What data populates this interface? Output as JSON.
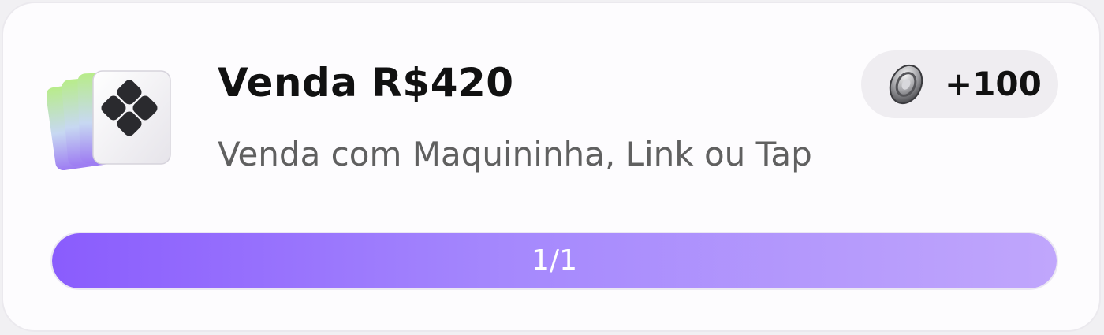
{
  "task": {
    "title": "Venda R$420",
    "subtitle": "Venda com Maquininha, Link ou Tap",
    "icon": "pix-cards-icon",
    "reward": {
      "icon": "coin-icon",
      "label": "+100"
    },
    "progress": {
      "label": "1/1",
      "fraction": 1.0,
      "fill_color_start": "#8a5cfd",
      "fill_color_end": "#c0a6fc"
    }
  }
}
